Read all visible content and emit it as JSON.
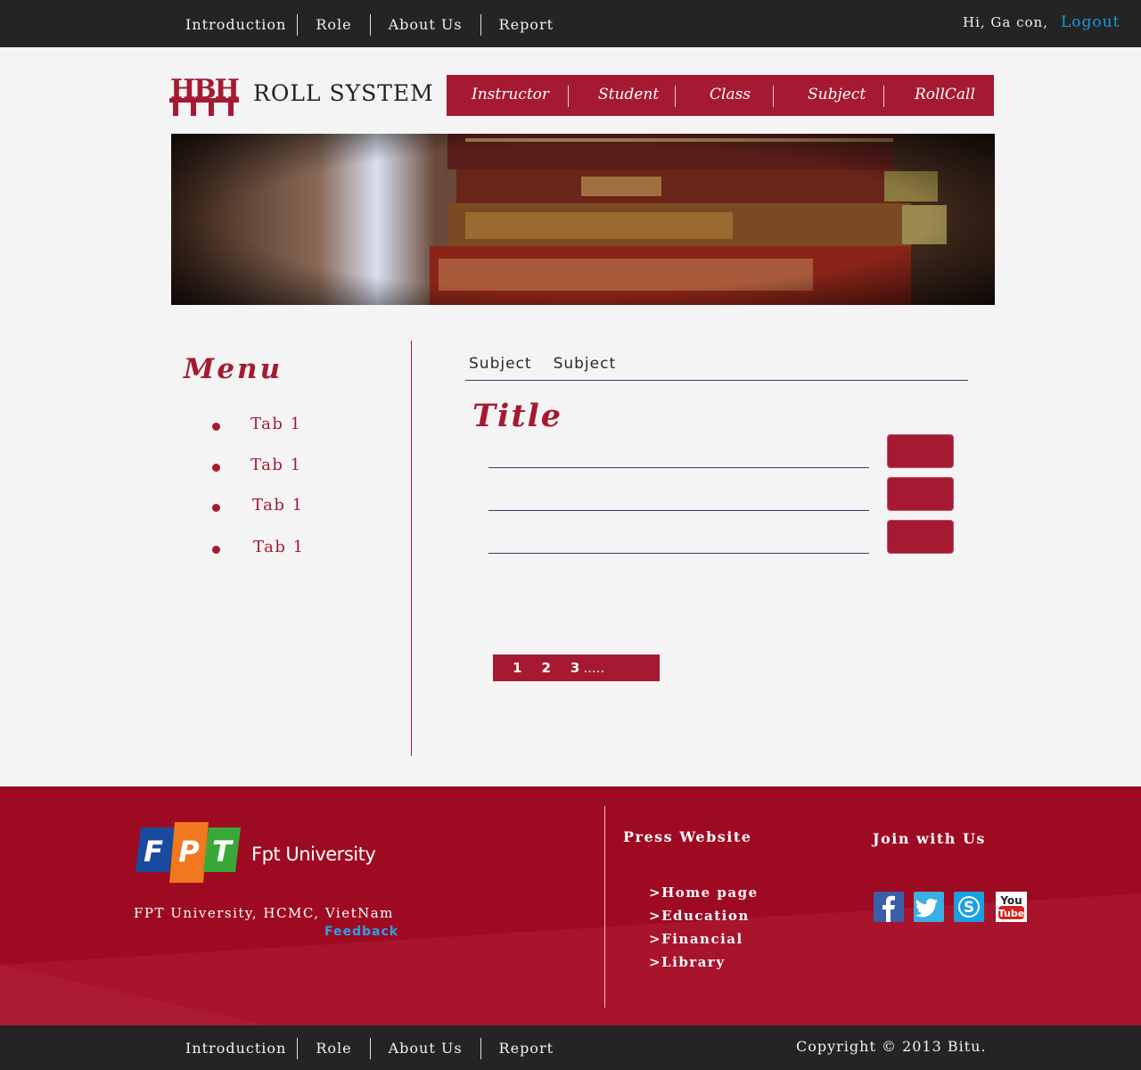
{
  "topbar": {
    "nav": [
      "Introduction",
      "Role",
      "About Us",
      "Report"
    ],
    "greeting": "Hi, Ga con,",
    "logout": "Logout"
  },
  "header": {
    "logo_text": "HBH",
    "brand": "ROLL SYSTEM",
    "nav": [
      "Instructor",
      "Student",
      "Class",
      "Subject",
      "RollCall"
    ]
  },
  "sidebar": {
    "title": "Menu",
    "items": [
      "Tab 1",
      "Tab 1",
      "Tab 1",
      "Tab 1"
    ]
  },
  "content": {
    "tabs": [
      "Subject",
      "Subject"
    ],
    "title": "Title",
    "pager": {
      "pages": [
        "1",
        "2",
        "3"
      ],
      "more": "....."
    }
  },
  "footer": {
    "fpt_logo_text": "FPT",
    "university": "Fpt University",
    "address": "FPT University, HCMC, VietNam",
    "feedback": "Feedback",
    "press_title": "Press Website",
    "press_links": [
      ">Home page",
      ">Education",
      ">Financial",
      ">Library"
    ],
    "join_title": "Join with Us",
    "social_icons": [
      "facebook-icon",
      "twitter-icon",
      "skype-icon",
      "youtube-icon"
    ]
  },
  "bottombar": {
    "nav": [
      "Introduction",
      "Role",
      "About Us",
      "Report"
    ],
    "copyright": "Copyright © 2013 Bitu."
  },
  "colors": {
    "brand_red": "#a51a32",
    "footer_red": "#9e0a22",
    "dark_bar": "#242424",
    "link_blue": "#1a9be0"
  }
}
